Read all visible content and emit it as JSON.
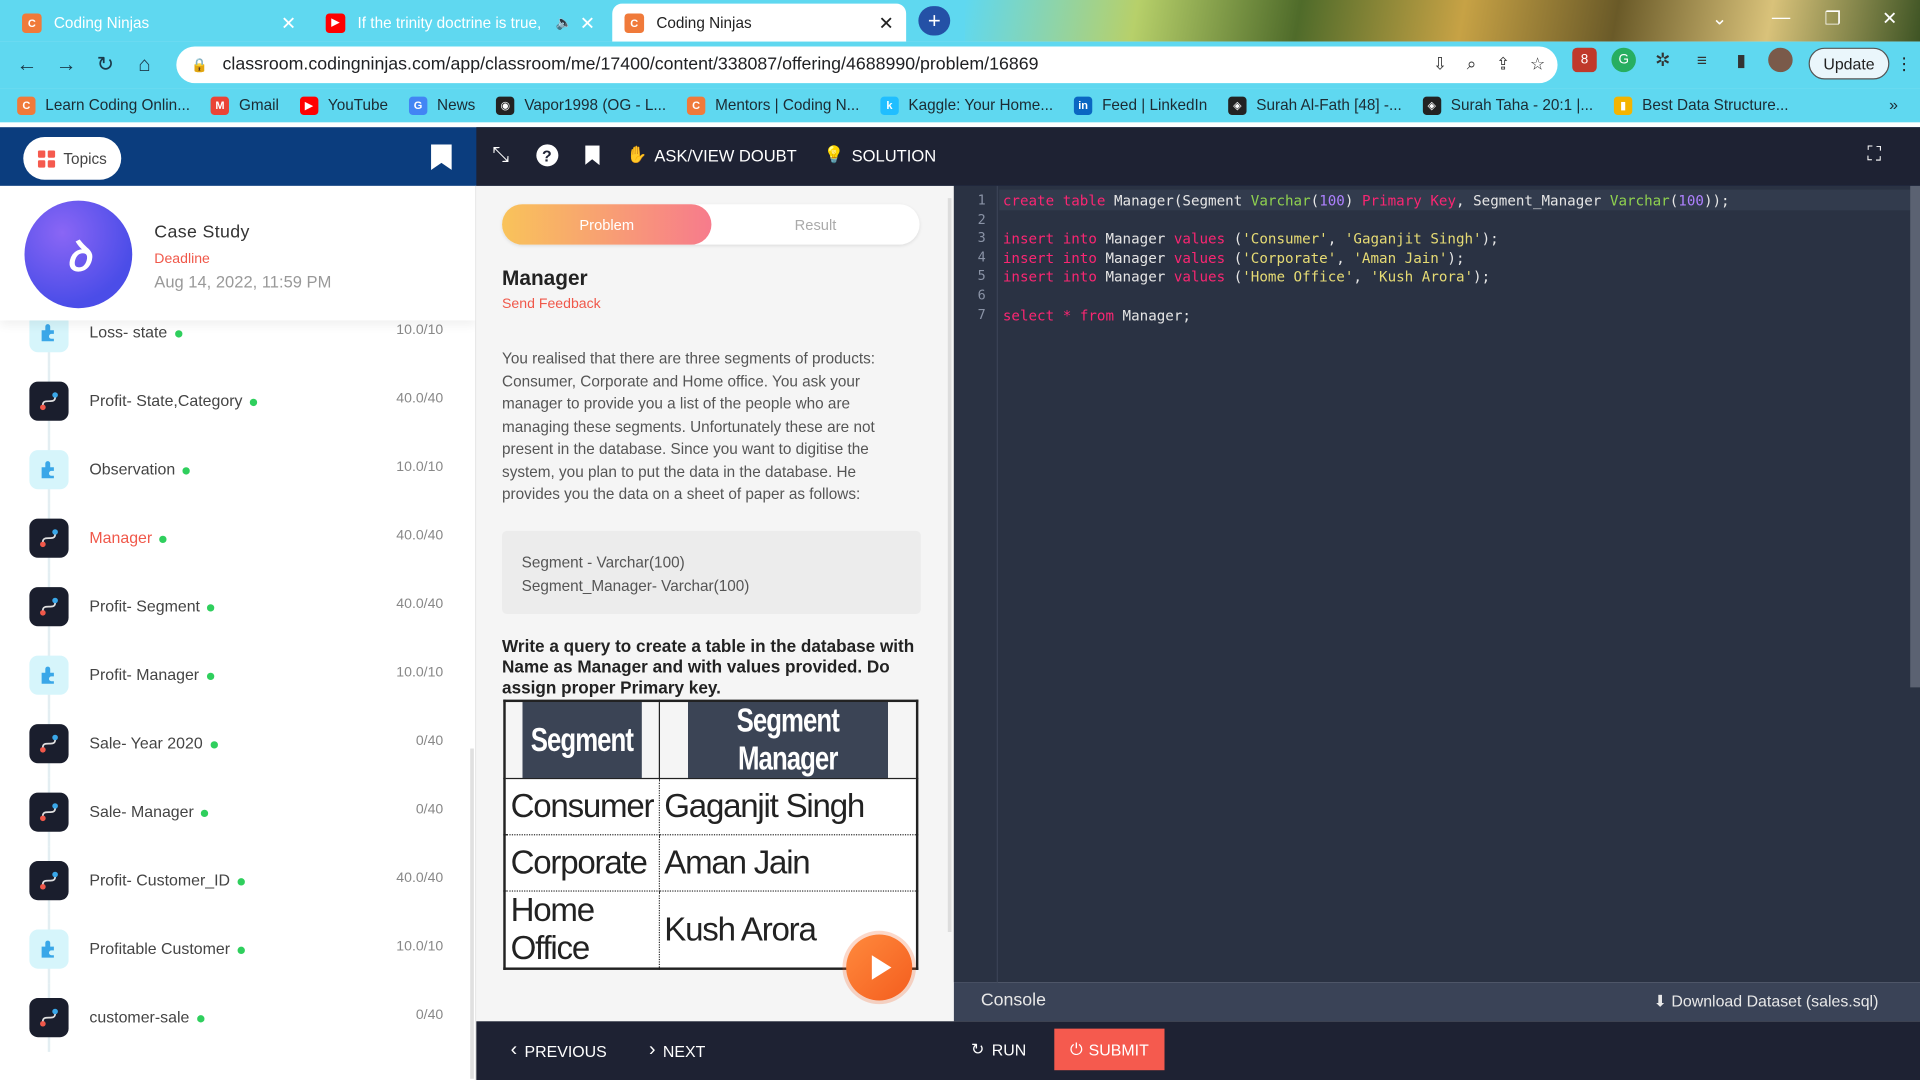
{
  "browser": {
    "tabs": [
      {
        "title": "Coding Ninjas",
        "close": "✕"
      },
      {
        "title": "If the trinity doctrine is true,",
        "close": "✕",
        "audio": "🔈"
      },
      {
        "title": "Coding Ninjas",
        "close": "✕"
      }
    ],
    "new_tab": "+",
    "url": "classroom.codingninjas.com/app/classroom/me/17400/content/338087/offering/4688990/problem/16869",
    "update_label": "Update",
    "bookmarks": [
      {
        "label": "Learn Coding Onlin...",
        "icon": "codingninjas-icon",
        "color": "#f07a3a",
        "glyph": "C"
      },
      {
        "label": "Gmail",
        "icon": "gmail-icon",
        "color": "#ea4335",
        "glyph": "M"
      },
      {
        "label": "YouTube",
        "icon": "youtube-icon",
        "color": "#ff0000",
        "glyph": "▶"
      },
      {
        "label": "News",
        "icon": "google-news-icon",
        "color": "#4285f4",
        "glyph": "G"
      },
      {
        "label": "Vapor1998 (OG - L...",
        "icon": "github-icon",
        "color": "#222222",
        "glyph": "◉"
      },
      {
        "label": "Mentors | Coding N...",
        "icon": "codingninjas-icon",
        "color": "#f07a3a",
        "glyph": "C"
      },
      {
        "label": "Kaggle: Your Home...",
        "icon": "kaggle-icon",
        "color": "#20beff",
        "glyph": "k"
      },
      {
        "label": "Feed | LinkedIn",
        "icon": "linkedin-icon",
        "color": "#0a66c2",
        "glyph": "in"
      },
      {
        "label": "Surah Al-Fath [48] -...",
        "icon": "quran-icon",
        "color": "#222222",
        "glyph": "◈"
      },
      {
        "label": "Surah Taha - 20:1 |...",
        "icon": "quran-icon",
        "color": "#222222",
        "glyph": "◈"
      },
      {
        "label": "Best Data Structure...",
        "icon": "chart-icon",
        "color": "#f4b400",
        "glyph": "▮"
      }
    ],
    "more_bookmarks": "»"
  },
  "header": {
    "topics_label": "Topics",
    "ask_doubt_label": "ASK/VIEW DOUBT",
    "solution_label": "SOLUTION",
    "help_glyph": "?"
  },
  "sidebar": {
    "case": {
      "title": "Case Study",
      "deadline_label": "Deadline",
      "deadline": "Aug 14, 2022, 11:59 PM"
    },
    "items": [
      {
        "label": "Loss- state",
        "score": "10.0/10",
        "kind": "light"
      },
      {
        "label": "Profit- State,Category",
        "score": "40.0/40",
        "kind": "dark"
      },
      {
        "label": "Observation",
        "score": "10.0/10",
        "kind": "light"
      },
      {
        "label": "Manager",
        "score": "40.0/40",
        "kind": "dark",
        "active": true
      },
      {
        "label": "Profit- Segment",
        "score": "40.0/40",
        "kind": "dark"
      },
      {
        "label": "Profit- Manager",
        "score": "10.0/10",
        "kind": "light"
      },
      {
        "label": "Sale- Year 2020",
        "score": "0/40",
        "kind": "dark"
      },
      {
        "label": "Sale- Manager",
        "score": "0/40",
        "kind": "dark"
      },
      {
        "label": "Profit- Customer_ID",
        "score": "40.0/40",
        "kind": "dark"
      },
      {
        "label": "Profitable Customer",
        "score": "10.0/10",
        "kind": "light"
      },
      {
        "label": "customer-sale",
        "score": "0/40",
        "kind": "dark"
      }
    ]
  },
  "problem": {
    "tab_problem": "Problem",
    "tab_result": "Result",
    "title": "Manager",
    "feedback": "Send Feedback",
    "description": "You realised that there are three segments of products: Consumer, Corporate and Home office. You ask your manager to provide you a list of the people who are managing these segments. Unfortunately these are not present in the database. Since you want to digitise the system, you plan to put the data in the database. He provides you the data on a sheet of paper as follows:",
    "schema_line1": "Segment - Varchar(100)",
    "schema_line2": "Segment_Manager- Varchar(100)",
    "query": "Write a query to create a table in the database with Name as Manager and with values provided. Do assign proper Primary key.",
    "table": {
      "headers": [
        "Segment",
        "Segment Manager"
      ],
      "rows": [
        [
          "Consumer",
          "Gaganjit Singh"
        ],
        [
          "Corporate",
          "Aman Jain"
        ],
        [
          "Home Office",
          "Kush Arora"
        ]
      ]
    }
  },
  "editor": {
    "line_numbers": [
      "1",
      "2",
      "3",
      "4",
      "5",
      "6",
      "7"
    ],
    "lines": [
      "create table Manager(Segment Varchar(100) Primary Key, Segment_Manager Varchar(100));",
      "",
      "insert into Manager values ('Consumer', 'Gaganjit Singh');",
      "insert into Manager values ('Corporate', 'Aman Jain');",
      "insert into Manager values ('Home Office', 'Kush Arora');",
      "",
      "select * from Manager;"
    ],
    "console_label": "Console",
    "download_label": "Download Dataset (sales.sql)"
  },
  "footer": {
    "previous": "PREVIOUS",
    "next": "NEXT",
    "run": "RUN",
    "submit": "SUBMIT"
  },
  "colors": {
    "accent": "#f0584a",
    "chrome": "#5fd8f0",
    "header_left": "#0b3d7e",
    "header_dark": "#1e2233",
    "editor_bg": "#2a3243",
    "done_dot": "#2fcf5d"
  }
}
